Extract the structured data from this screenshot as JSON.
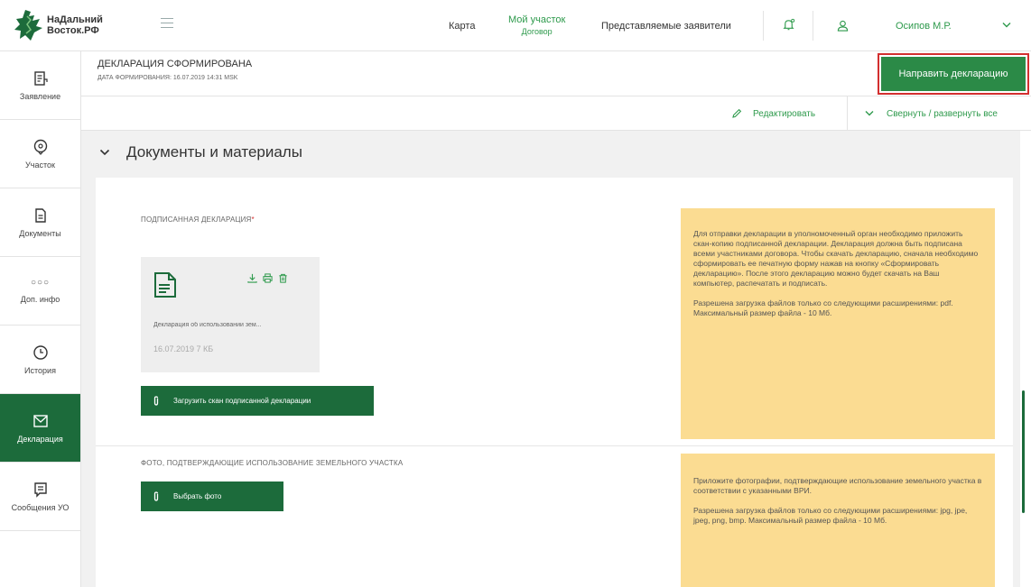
{
  "header": {
    "logo_line1": "НаДальний",
    "logo_line2": "Восток.РФ",
    "nav_map": "Карта",
    "nav_my_plot": "Мой участок",
    "nav_my_plot_sub": "Договор",
    "nav_representatives": "Представляемые заявители",
    "user_name": "Осипов М.Р."
  },
  "sidebar": {
    "items": [
      {
        "label": "Заявление",
        "icon": "document-edit-icon"
      },
      {
        "label": "Участок",
        "icon": "location-pin-icon"
      },
      {
        "label": "Документы",
        "icon": "document-icon"
      },
      {
        "label": "Доп. инфо",
        "icon": "dots-icon"
      },
      {
        "label": "История",
        "icon": "clock-icon"
      },
      {
        "label": "Декларация",
        "icon": "mail-icon",
        "active": true
      },
      {
        "label": "Сообщения УО",
        "icon": "message-icon"
      }
    ]
  },
  "status": {
    "title": "ДЕКЛАРАЦИЯ СФОРМИРОВАНА",
    "date": "ДАТА ФОРМИРОВАНИЯ: 16.07.2019 14:31 MSK",
    "send_button": "Направить декларацию"
  },
  "toolbar": {
    "edit": "Редактировать",
    "collapse": "Свернуть / развернуть все"
  },
  "section": {
    "title": "Документы и материалы"
  },
  "signed": {
    "label": "ПОДПИСАННАЯ ДЕКЛАРАЦИЯ",
    "required_mark": "*",
    "file_name": "Декларация об использовании зем...",
    "file_meta": "16.07.2019  7 КБ",
    "upload_button": "Загрузить скан подписанной декларации",
    "info_p1": "Для отправки декларации в уполномоченный орган необходимо приложить скан-копию подписанной декларации. Декларация должна быть подписана всеми участниками договора. Чтобы скачать декларацию, сначала необходимо сформировать ее печатную форму нажав на кнопку «Сформировать декларацию». После этого декларацию можно будет скачать на Ваш компьютер, распечатать и подписать.",
    "info_p2": "Разрешена загрузка файлов только со следующими расширениями: pdf. Максимальный размер файла - 10 Мб."
  },
  "photos": {
    "label": "ФОТО, ПОДТВЕРЖДАЮЩИЕ ИСПОЛЬЗОВАНИЕ ЗЕМЕЛЬНОГО УЧАСТКА",
    "upload_button": "Выбрать фото",
    "info_p1": "Приложите фотографии, подтверждающие использование земельного участка в соответствии с указанными ВРИ.",
    "info_p2": "Разрешена загрузка файлов только со следующими расширениями: jpg, jpe, jpeg, png, bmp. Максимальный размер файла - 10 Мб."
  },
  "colors": {
    "brand_green": "#1c6b3b",
    "accent_green": "#2e9a4c",
    "info_yellow": "#fbdc92",
    "highlight_red": "#d32f2f"
  }
}
